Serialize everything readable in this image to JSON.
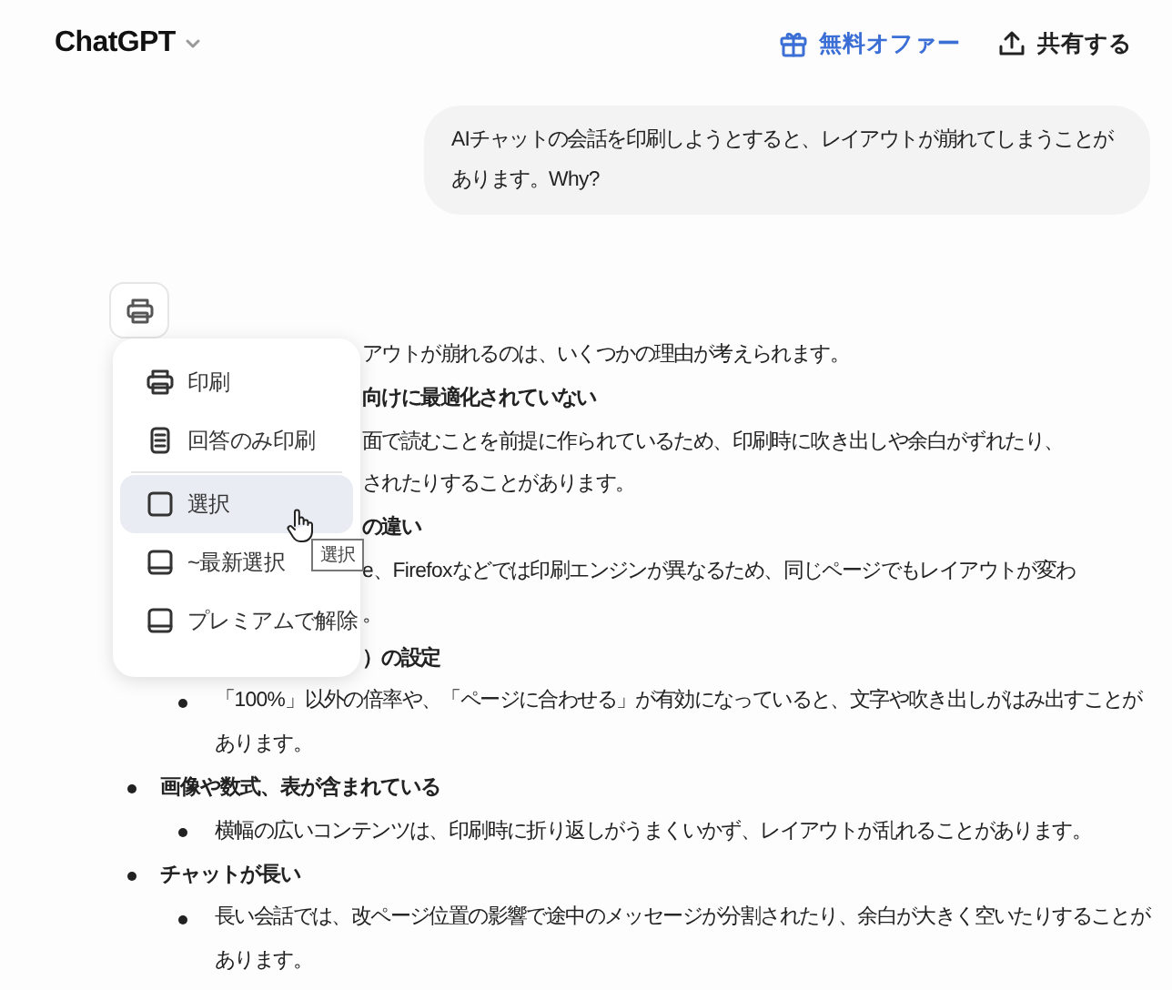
{
  "header": {
    "title": "ChatGPT",
    "offer": "無料オファー",
    "share": "共有する"
  },
  "user_message": "AIチャットの会話を印刷しようとすると、レイアウトが崩れてしまうことがあります。Why?",
  "answer": {
    "partial_lines": [
      {
        "kind": "text",
        "text": "アウトが崩れるのは、いくつかの理由が考えられます。"
      },
      {
        "kind": "heading",
        "text": "向けに最適化されていない"
      },
      {
        "kind": "text",
        "text": "面で読むことを前提に作られているため、印刷時に吹き出しや余白がずれたり、"
      },
      {
        "kind": "text",
        "text": "されたりすることがあります。"
      },
      {
        "kind": "heading",
        "text": "の違い"
      },
      {
        "kind": "text",
        "text": "e、Firefoxなどでは印刷エンジンが異なるため、同じページでもレイアウトが変わ"
      },
      {
        "kind": "text",
        "text": "。"
      },
      {
        "kind": "heading",
        "text": "）の設定"
      }
    ],
    "sections": [
      {
        "points": [
          "「100%」以外の倍率や、「ページに合わせる」が有効になっていると、文字や吹き出しがはみ出すことがあります。"
        ]
      },
      {
        "heading": "画像や数式、表が含まれている",
        "points": [
          "横幅の広いコンテンツは、印刷時に折り返しがうまくいかず、レイアウトが乱れることがあります。"
        ]
      },
      {
        "heading": "チャットが長い",
        "points": [
          "長い会話では、改ページ位置の影響で途中のメッセージが分割されたり、余白が大きく空いたりすることがあります。"
        ]
      }
    ]
  },
  "menu": {
    "groups": [
      [
        {
          "kind": "printer",
          "label": "印刷",
          "hovered": false
        },
        {
          "kind": "document",
          "label": "回答のみ印刷",
          "hovered": false
        }
      ],
      [
        {
          "kind": "square",
          "label": "選択",
          "hovered": true
        },
        {
          "kind": "book",
          "label": "~最新選択",
          "hovered": false
        },
        {
          "kind": "book",
          "label": "プレミアムで解除",
          "hovered": false
        }
      ]
    ]
  },
  "tooltip": "選択"
}
